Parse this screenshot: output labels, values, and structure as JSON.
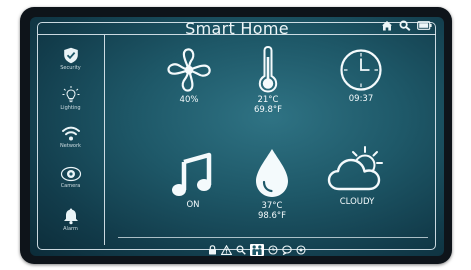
{
  "header": {
    "title": "Smart Home"
  },
  "sidebar": {
    "items": [
      {
        "label": "Security",
        "icon": "shield-check-icon"
      },
      {
        "label": "Lighting",
        "icon": "bulb-icon"
      },
      {
        "label": "Network",
        "icon": "wifi-icon"
      },
      {
        "label": "Camera",
        "icon": "camera-icon"
      },
      {
        "label": "Alarm",
        "icon": "bell-icon"
      }
    ]
  },
  "tiles": [
    {
      "icon": "fan-icon",
      "value": "40%"
    },
    {
      "icon": "thermometer-icon",
      "value": "21°C",
      "value2": "69.8°F"
    },
    {
      "icon": "clock-icon",
      "value": "09:37"
    },
    {
      "icon": "music-note-icon",
      "value": "ON"
    },
    {
      "icon": "water-drop-icon",
      "value": "37°C",
      "value2": "98.6°F"
    },
    {
      "icon": "cloudy-sun-icon",
      "value": "CLOUDY"
    }
  ],
  "status_icons": [
    "home-icon",
    "search-icon",
    "battery-icon"
  ],
  "bottom_tabs": [
    "lock-icon",
    "warning-icon",
    "search-icon",
    "family-icon",
    "clock-icon",
    "chat-icon",
    "settings-icon"
  ],
  "colors": {
    "screen": "#1e5868",
    "foreground": "#eef6f8",
    "bezel": "#0e141a"
  }
}
